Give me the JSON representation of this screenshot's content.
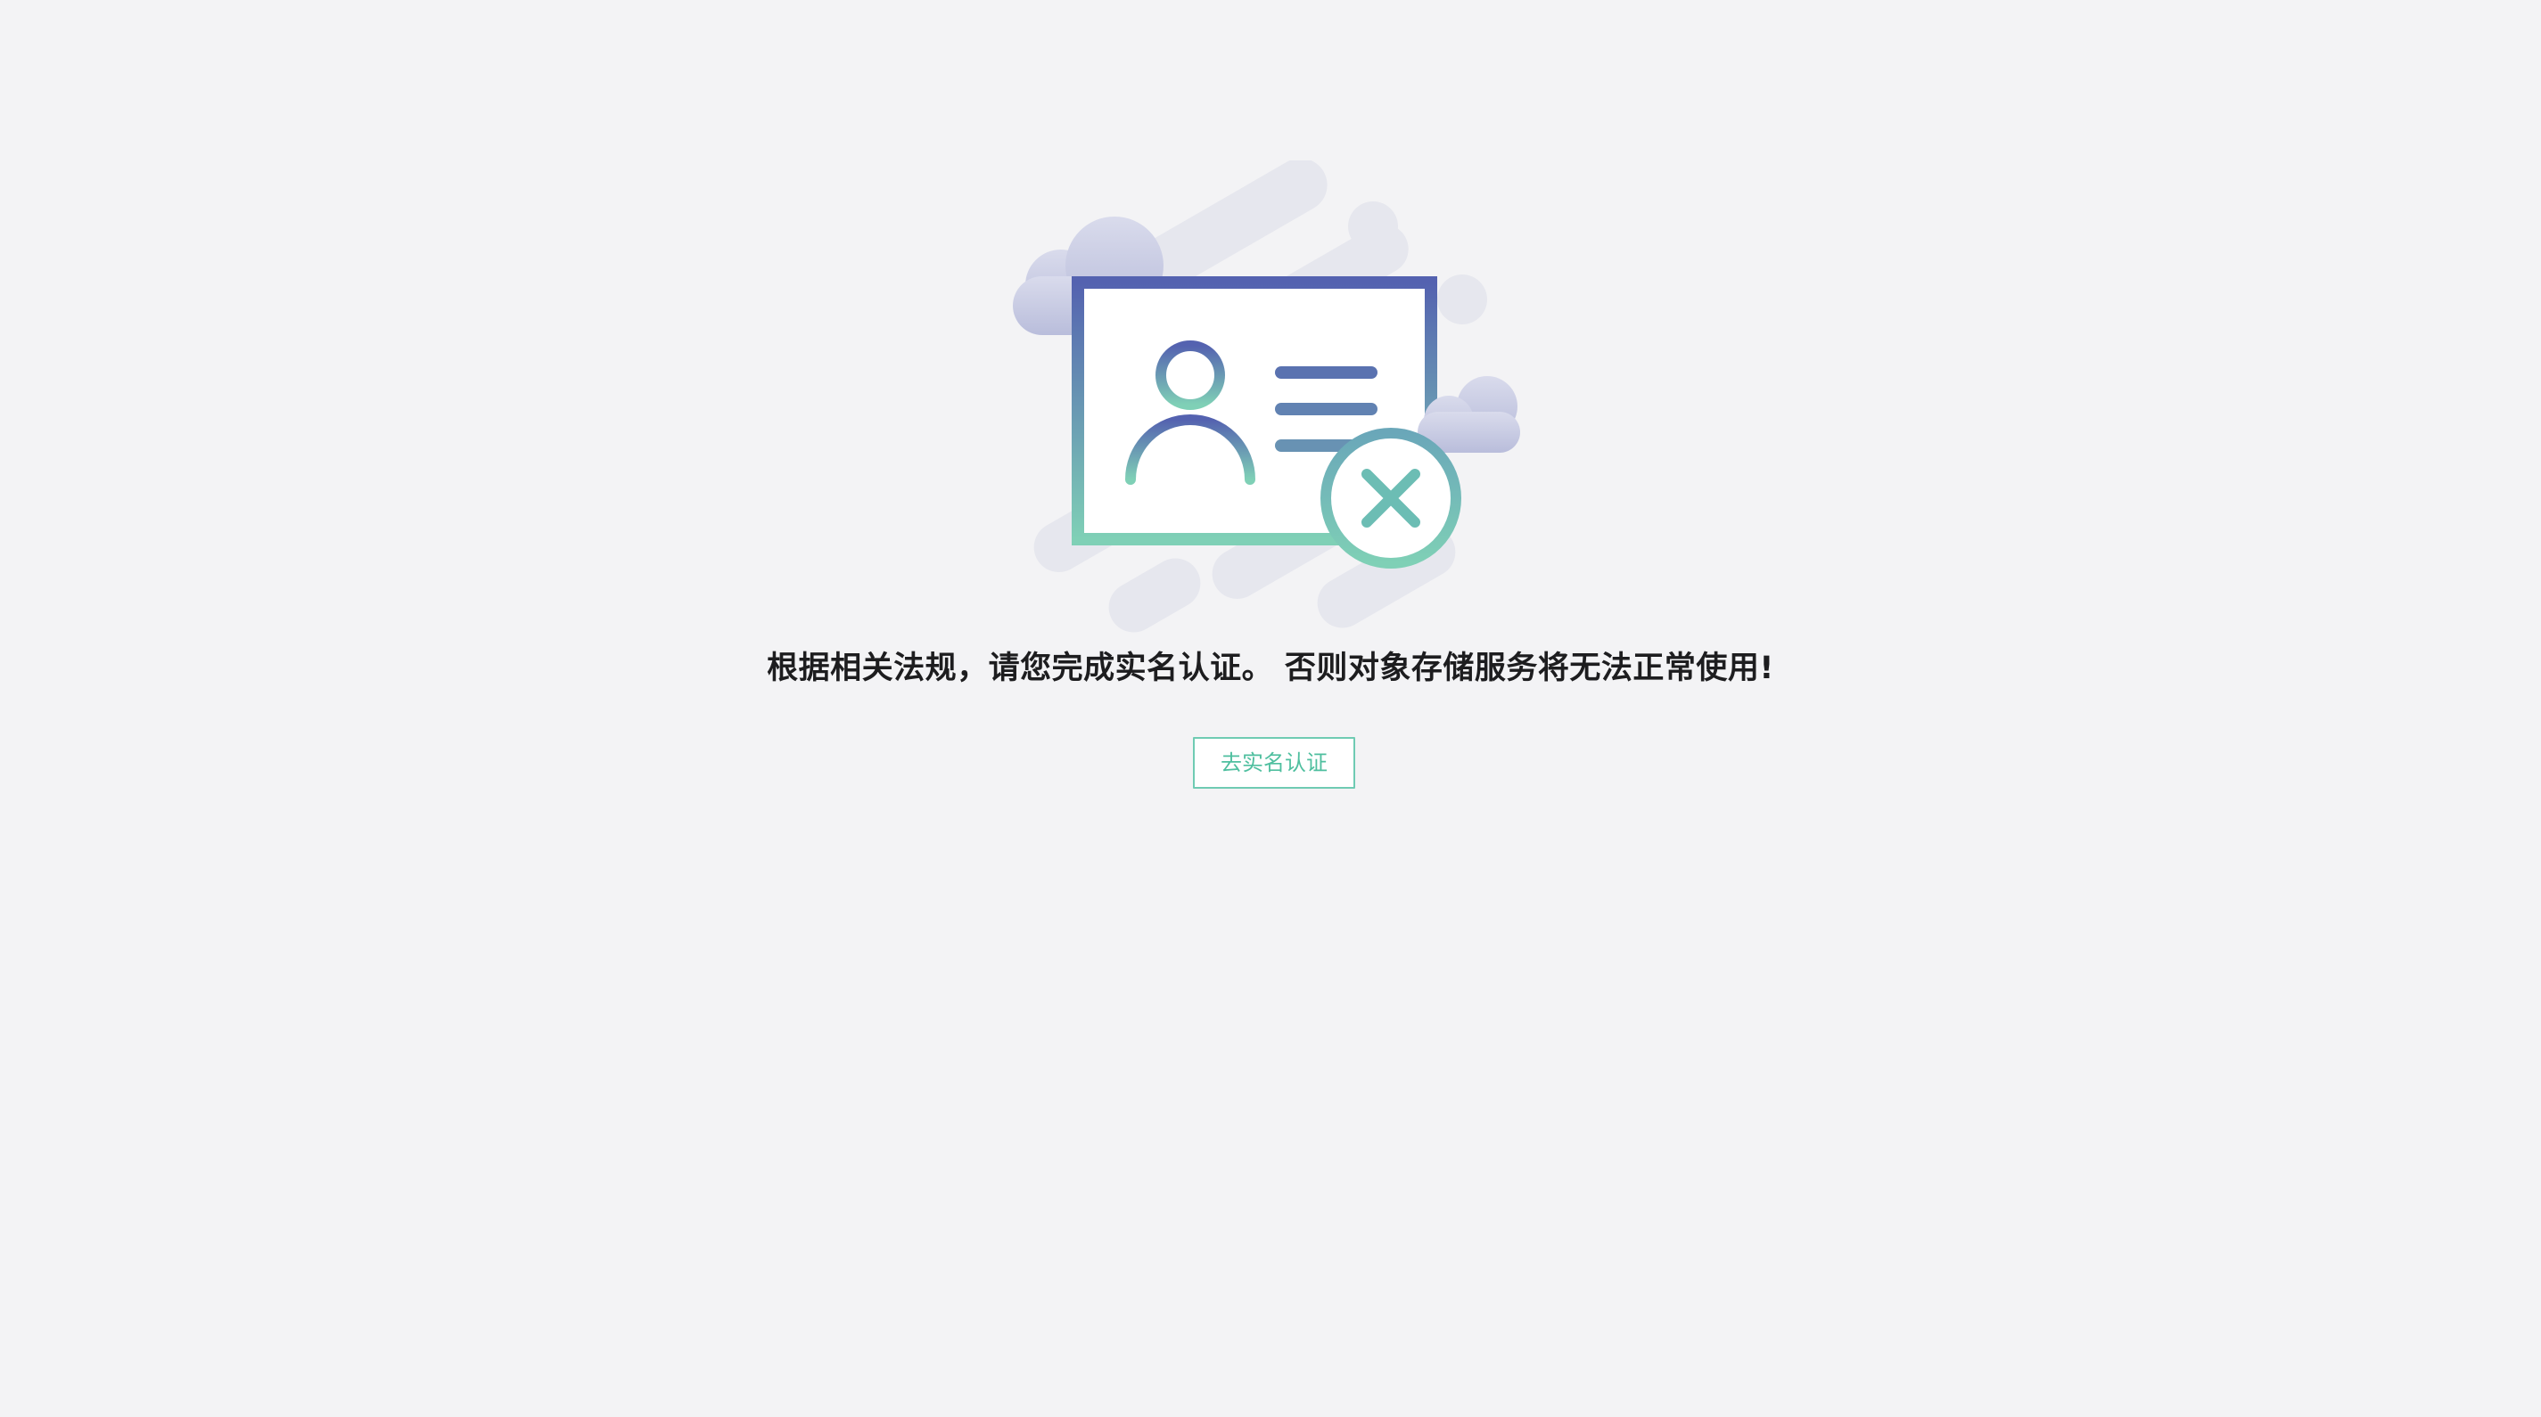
{
  "illustration": {
    "icon": "id-card-x-icon",
    "colors": {
      "gradient_top": "#5462b0",
      "gradient_bottom": "#7fd0b6",
      "decor": "#e6e7ee",
      "cloud": "#c9cce3"
    }
  },
  "notice": {
    "text": "根据相关法规，请您完成实名认证。 否则对象存储服务将无法正常使用!"
  },
  "action": {
    "verify_label": "去实名认证",
    "accent": "#4fbf9f"
  }
}
